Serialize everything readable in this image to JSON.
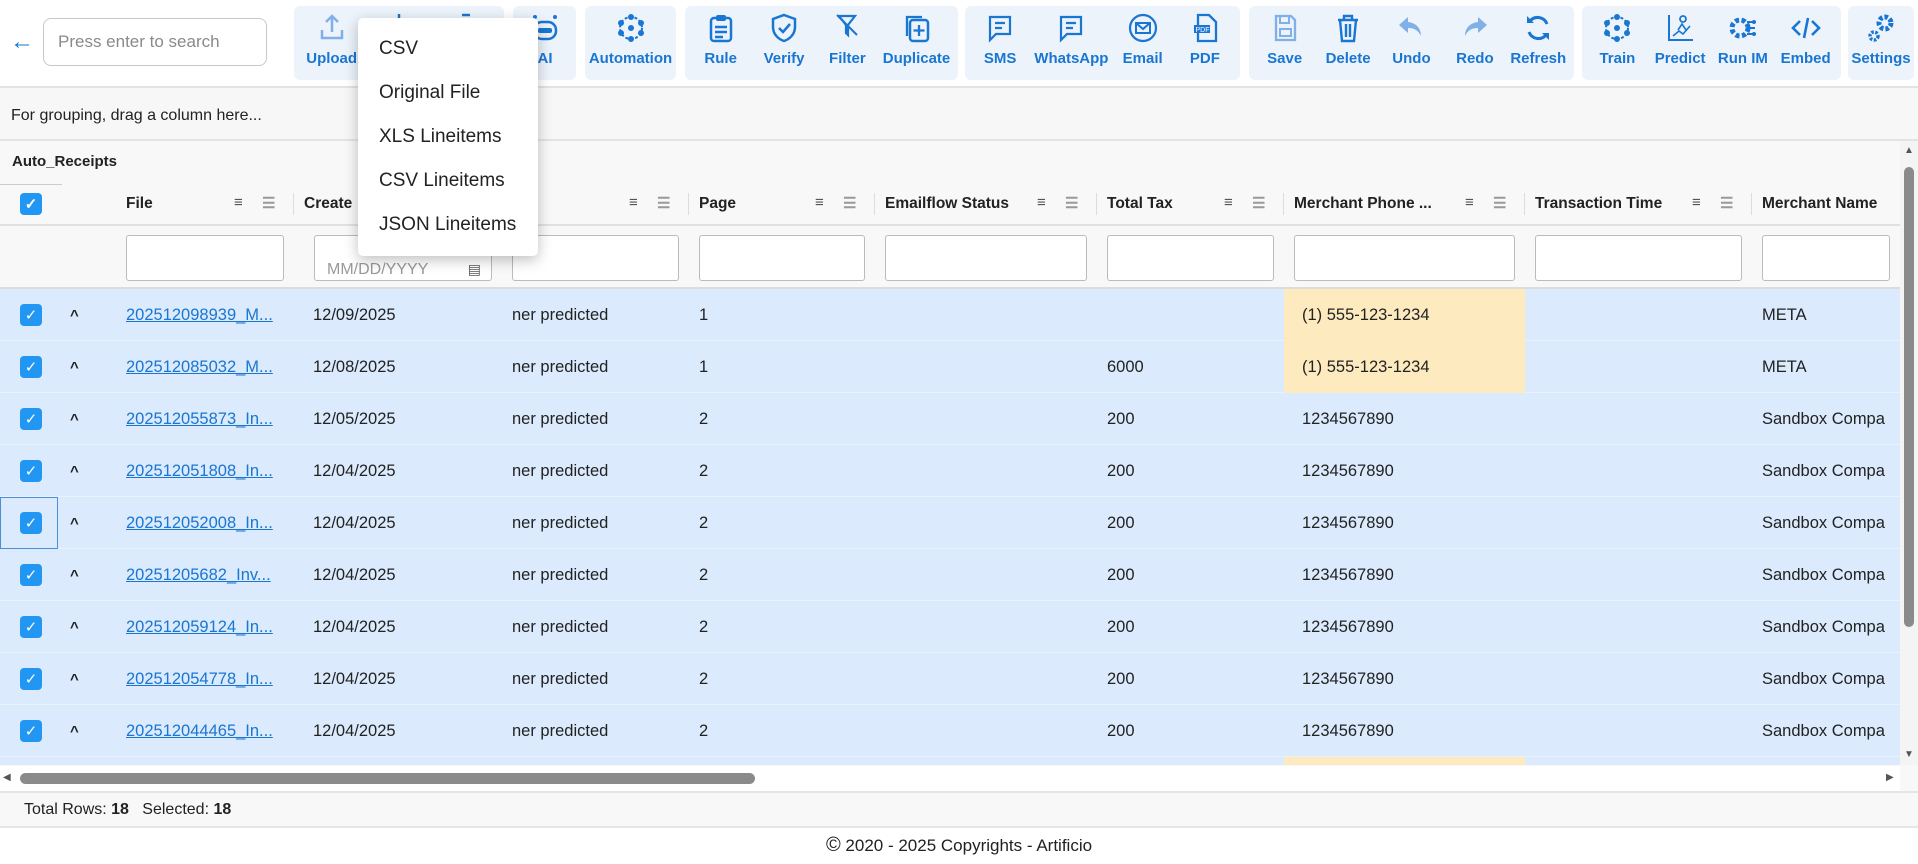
{
  "toolbar": {
    "search_placeholder": "Press enter to search",
    "groups": [
      {
        "buttons": [
          {
            "label": "Upload",
            "icon": "upload-icon"
          },
          {
            "label": "",
            "icon": "download-icon"
          },
          {
            "label": "",
            "icon": "export-icon"
          }
        ]
      },
      {
        "buttons": [
          {
            "label": "AI",
            "icon": "robot-icon"
          }
        ]
      },
      {
        "buttons": [
          {
            "label": "Automation",
            "icon": "network-icon"
          }
        ]
      },
      {
        "buttons": [
          {
            "label": "Rule",
            "icon": "clipboard-list-icon"
          },
          {
            "label": "Verify",
            "icon": "shield-check-icon"
          },
          {
            "label": "Filter",
            "icon": "filter-off-icon"
          },
          {
            "label": "Duplicate",
            "icon": "copy-plus-icon"
          }
        ]
      },
      {
        "buttons": [
          {
            "label": "SMS",
            "icon": "message-icon"
          },
          {
            "label": "WhatsApp",
            "icon": "chat-icon"
          },
          {
            "label": "Email",
            "icon": "envelope-icon"
          },
          {
            "label": "PDF",
            "icon": "pdf-file-icon"
          }
        ]
      },
      {
        "buttons": [
          {
            "label": "Save",
            "icon": "floppy-icon"
          },
          {
            "label": "Delete",
            "icon": "trash-icon"
          },
          {
            "label": "Undo",
            "icon": "undo-icon"
          },
          {
            "label": "Redo",
            "icon": "redo-icon"
          },
          {
            "label": "Refresh",
            "icon": "refresh-icon"
          }
        ]
      },
      {
        "buttons": [
          {
            "label": "Train",
            "icon": "network-icon"
          },
          {
            "label": "Predict",
            "icon": "chart-person-icon"
          },
          {
            "label": "Run IM",
            "icon": "cog-circuit-icon"
          },
          {
            "label": "Embed",
            "icon": "code-icon"
          }
        ]
      },
      {
        "buttons": [
          {
            "label": "Settings",
            "icon": "gears-icon"
          }
        ]
      }
    ]
  },
  "download_menu": [
    "CSV",
    "Original File",
    "XLS Lineitems",
    "CSV Lineitems",
    "JSON Lineitems"
  ],
  "grouping_hint": "For grouping, drag a column here...",
  "grid": {
    "tab": "Auto_Receipts",
    "columns": [
      "File",
      "Create",
      "tus",
      "Page",
      "Emailflow Status",
      "Total Tax",
      "Merchant Phone ...",
      "Transaction Time",
      "Merchant Name"
    ],
    "date_placeholder": "MM/DD/YYYY",
    "rows": [
      [
        "202512098939_M...",
        "12/09/2025",
        "ner predicted",
        "1",
        "",
        "",
        "(1) 555-123-1234",
        "",
        "META"
      ],
      [
        "202512085032_M...",
        "12/08/2025",
        "ner predicted",
        "1",
        "",
        "6000",
        "(1) 555-123-1234",
        "",
        "META"
      ],
      [
        "202512055873_In...",
        "12/05/2025",
        "ner predicted",
        "2",
        "",
        "200",
        "1234567890",
        "",
        "Sandbox Compa"
      ],
      [
        "202512051808_In...",
        "12/04/2025",
        "ner predicted",
        "2",
        "",
        "200",
        "1234567890",
        "",
        "Sandbox Compa"
      ],
      [
        "202512052008_In...",
        "12/04/2025",
        "ner predicted",
        "2",
        "",
        "200",
        "1234567890",
        "",
        "Sandbox Compa"
      ],
      [
        "20251205682_Inv...",
        "12/04/2025",
        "ner predicted",
        "2",
        "",
        "200",
        "1234567890",
        "",
        "Sandbox Compa"
      ],
      [
        "202512059124_In...",
        "12/04/2025",
        "ner predicted",
        "2",
        "",
        "200",
        "1234567890",
        "",
        "Sandbox Compa"
      ],
      [
        "202512054778_In...",
        "12/04/2025",
        "ner predicted",
        "2",
        "",
        "200",
        "1234567890",
        "",
        "Sandbox Compa"
      ],
      [
        "202512044465_In...",
        "12/04/2025",
        "ner predicted",
        "2",
        "",
        "200",
        "1234567890",
        "",
        "Sandbox Compa"
      ],
      [
        "",
        "",
        "",
        "",
        "",
        "",
        "",
        "",
        ""
      ]
    ],
    "highlight_rows": [
      0,
      1,
      9
    ],
    "highlight_color": "#fdebbf",
    "row_color": "#dbeafd",
    "accent": "#1976d2"
  },
  "status": {
    "total_label": "Total Rows:",
    "total": "18",
    "selected_label": "Selected:",
    "selected": "18"
  },
  "footer": {
    "copyright": "2020 - 2025 Copyrights - Artificio"
  }
}
